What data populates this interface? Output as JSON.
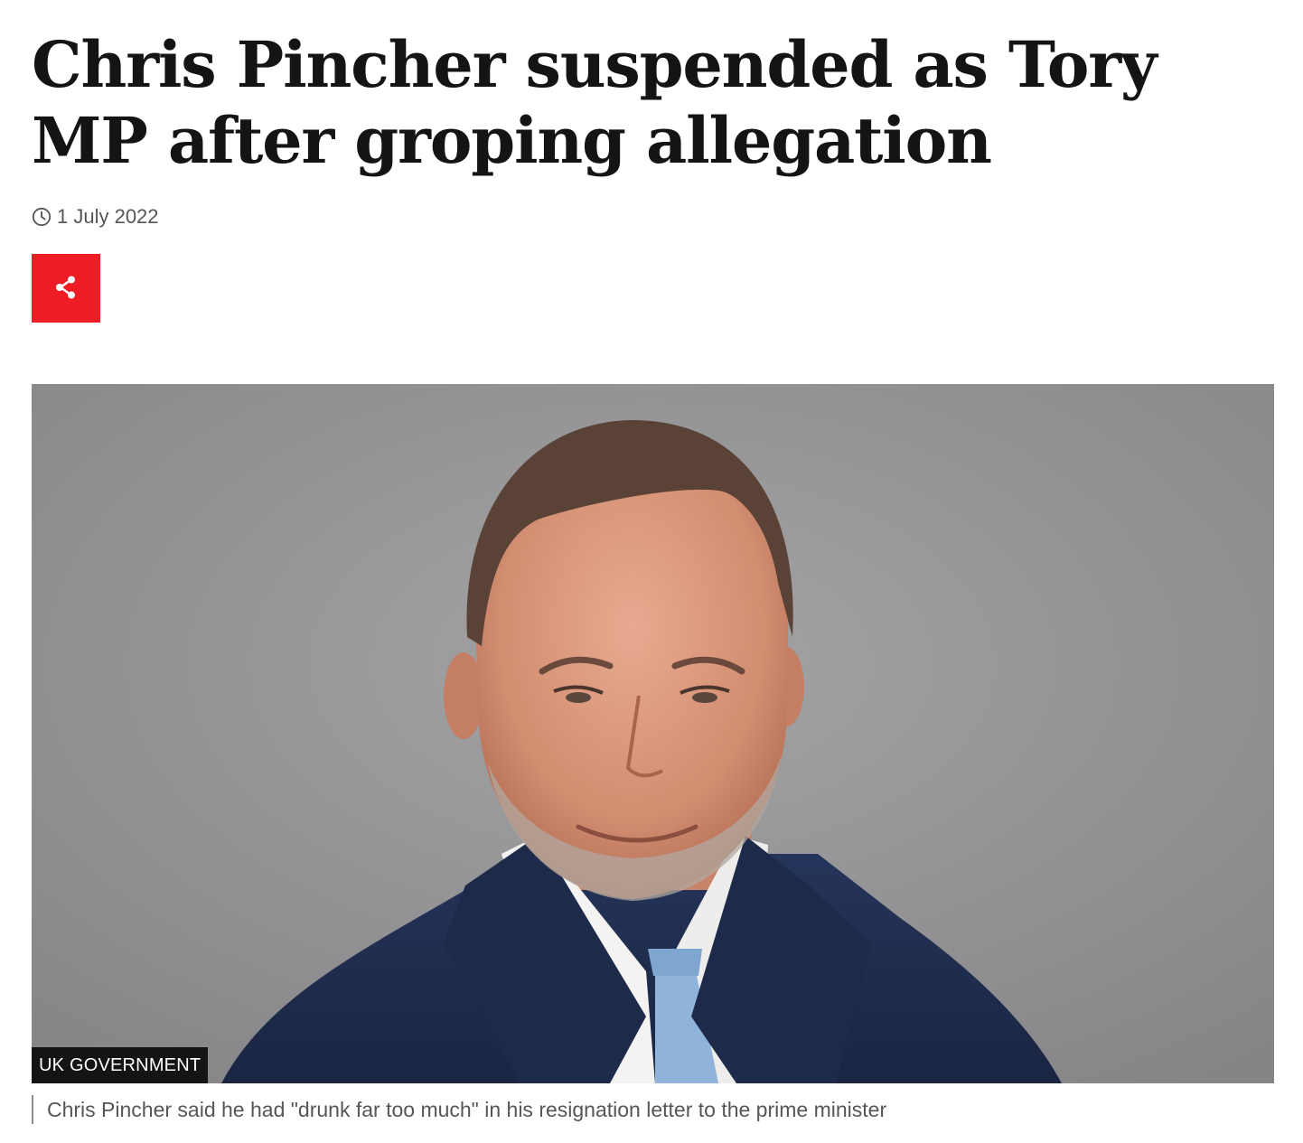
{
  "article": {
    "headline": "Chris Pincher suspended as Tory MP after groping allegation",
    "date": "1 July 2022",
    "icons": {
      "timestamp": "clock-icon",
      "share": "share-icon"
    },
    "colors": {
      "accent": "#ee1c25",
      "text": "#141414",
      "meta": "#545658"
    },
    "image": {
      "credit": "UK GOVERNMENT",
      "caption": "Chris Pincher said he had \"drunk far too much\" in his resignation letter to the prime minister"
    }
  }
}
